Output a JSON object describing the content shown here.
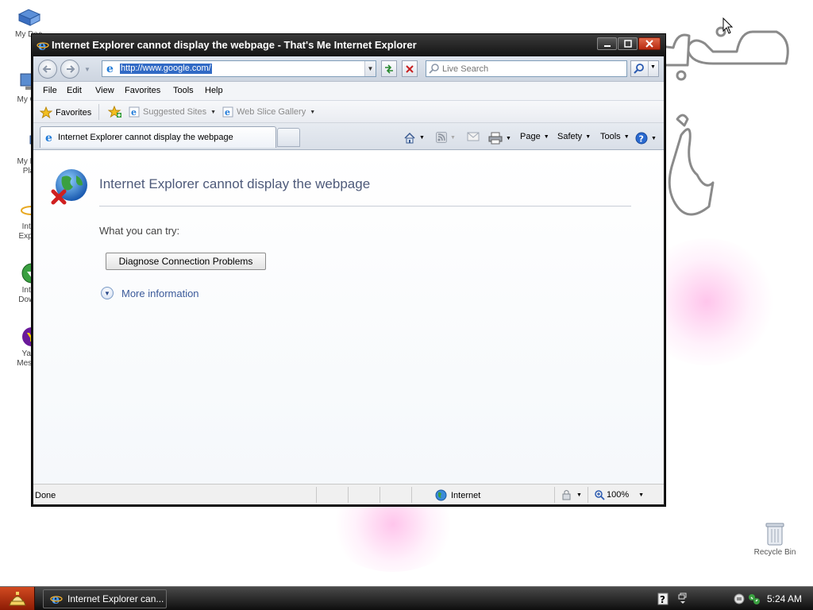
{
  "desktop": {
    "icons": [
      {
        "label": "My Doc",
        "icon": "documents-icon"
      },
      {
        "label": "My Co",
        "icon": "computer-icon"
      },
      {
        "label": "My Ne\nPla",
        "icon": "network-icon"
      },
      {
        "label": "Inte\nExplo",
        "icon": "ie-icon"
      },
      {
        "label": "Inte\nDown",
        "icon": "download-icon"
      },
      {
        "label": "Yah\nMesse",
        "icon": "yahoo-icon"
      }
    ],
    "recycle_bin": "Recycle Bin"
  },
  "window": {
    "title": "Internet Explorer cannot display the webpage - That's Me Internet Explorer"
  },
  "address_bar": {
    "url": "http://www.google.com/",
    "search_placeholder": "Live Search"
  },
  "menu": [
    "File",
    "Edit",
    "View",
    "Favorites",
    "Tools",
    "Help"
  ],
  "favorites_bar": {
    "favorites_label": "Favorites",
    "suggested_sites": "Suggested Sites",
    "web_slice_gallery": "Web Slice Gallery"
  },
  "tab": {
    "label": "Internet Explorer cannot display the webpage"
  },
  "command_bar": {
    "page": "Page",
    "safety": "Safety",
    "tools": "Tools"
  },
  "page": {
    "heading": "Internet Explorer cannot display the webpage",
    "try_text": "What you can try:",
    "diagnose_button": "Diagnose Connection Problems",
    "more_info": "More information"
  },
  "status": {
    "text": "Done",
    "zone": "Internet",
    "zoom": "100%"
  },
  "taskbar": {
    "task_label": "Internet Explorer can...",
    "clock": "5:24 AM"
  }
}
